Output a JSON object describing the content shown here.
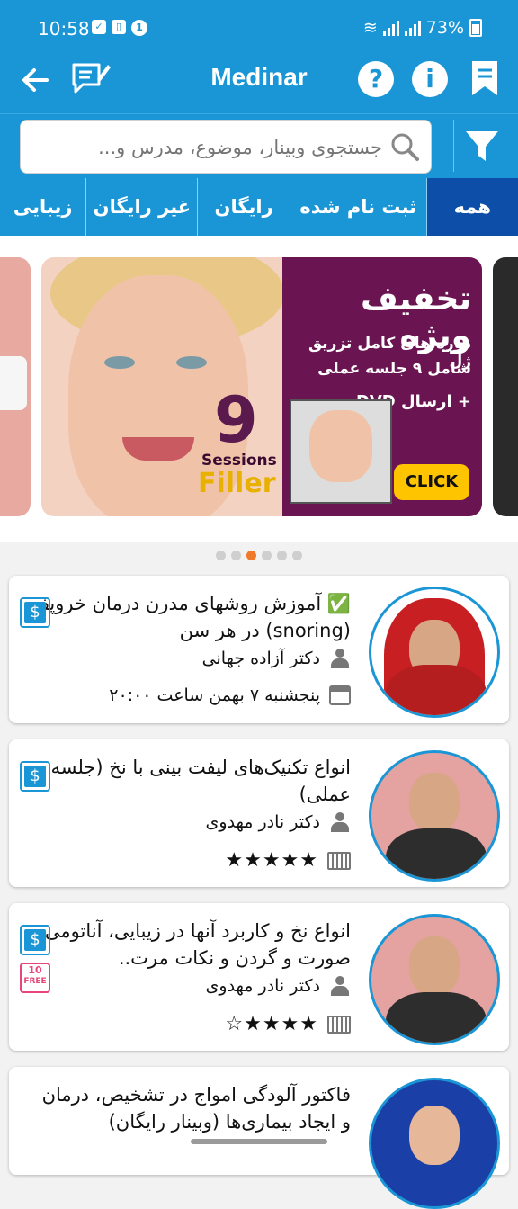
{
  "status_bar": {
    "time": "10:58",
    "notif_count": "1",
    "battery": "73%"
  },
  "app_bar": {
    "title": "Medinar"
  },
  "search": {
    "placeholder": "جستجوی وبینار، موضوع، مدرس و..."
  },
  "tabs": [
    {
      "label": "زیبایی",
      "width": 96
    },
    {
      "label": "غیر رایگان",
      "width": 124
    },
    {
      "label": "رایگان",
      "width": 102
    },
    {
      "label": "ثبت نام شده",
      "width": 152
    },
    {
      "label": "همه",
      "width": 102,
      "active": true
    }
  ],
  "banner": {
    "heading": "تخفیف ویژه",
    "line1": "دوره های کامل تزریق ژل",
    "line2": "شامل ۹ جلسه عملی",
    "line3": "+ ارسال DVD",
    "number": "9",
    "sessions": "Sessions",
    "product": "Filler",
    "cta": "CLICK"
  },
  "carousel": {
    "count": 6,
    "active": 2
  },
  "webinars": [
    {
      "title": "✅ آموزش روشهای مدرن درمان خروپف (snoring) در هر سن",
      "teacher": "دکتر آزاده جهانی",
      "meta": "پنجشنبه ۷ بهمن ساعت ۲۰:۰۰",
      "meta_type": "calendar",
      "paid": true,
      "free10": false,
      "avatar": "red"
    },
    {
      "title": "انواع تکنیک‌های لیفت بینی با نخ (جلسه عملی)",
      "teacher": "دکتر نادر مهدوی",
      "meta": "★★★★★",
      "meta_type": "video",
      "paid": true,
      "free10": false,
      "avatar": "suit"
    },
    {
      "title": "انواع نخ و کاربرد آنها در زیبایی، آناتومی صورت و گردن و نکات مرت..",
      "teacher": "دکتر نادر مهدوی",
      "meta": "★★★★☆",
      "meta_type": "video",
      "paid": true,
      "free10": true,
      "avatar": "suit"
    },
    {
      "title": "فاکتور آلودگی امواج در تشخیص، درمان و ایجاد بیماری‌ها (وبینار رایگان)",
      "teacher": "",
      "meta": "",
      "meta_type": "",
      "paid": false,
      "free10": false,
      "avatar": "blue"
    }
  ],
  "free10_label": {
    "num": "10",
    "text": "FREE"
  },
  "colors": {
    "primary": "#1a96d6",
    "active_tab": "#0d4fa8",
    "accent_dot": "#f07a2b"
  }
}
